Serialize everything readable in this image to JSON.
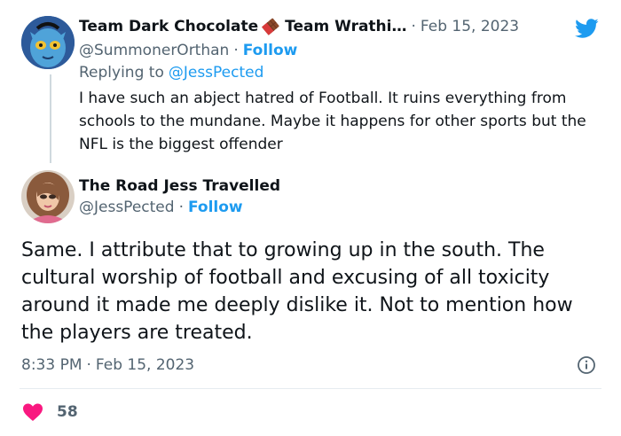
{
  "reply_tweet": {
    "display_name": "Team Dark Chocolate",
    "display_name_suffix": "Team Wrathi…",
    "separator_dot": "·",
    "date": "Feb 15, 2023",
    "handle": "@SummonerOrthan",
    "follow_label": "Follow",
    "replying_prefix": "Replying to",
    "replying_to": "@JessPected",
    "text": "I have such an abject hatred of Football. It ruins everything from schools to the mundane. Maybe it happens for other sports but the NFL is the biggest offender"
  },
  "main_tweet": {
    "display_name": "The Road Jess Travelled",
    "handle": "@JessPected",
    "separator_dot": "·",
    "follow_label": "Follow",
    "text": "Same. I attribute that to growing up in the south. The cultural worship of football and excusing of all toxicity around it made me deeply dislike it. Not to mention how the players are treated.",
    "time": "8:33 PM",
    "date": "Feb 15, 2023",
    "likes": "58"
  },
  "colors": {
    "accent": "#1d9bf0",
    "like_red": "#f91880",
    "muted": "#536471"
  },
  "icons": {
    "brand": "twitter-bird-icon",
    "info": "info-icon",
    "like": "heart-icon",
    "emoji": "chocolate-bar-icon"
  }
}
